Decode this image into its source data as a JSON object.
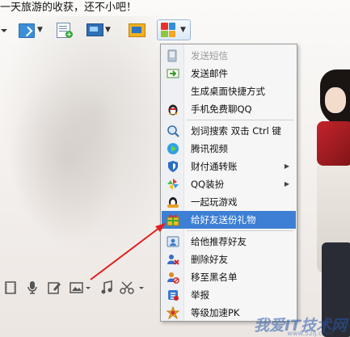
{
  "window": {
    "title": "一天旅游的收获，还不小吧！"
  },
  "toolbar": {
    "buttons": [
      {
        "name": "expand-arrow",
        "icon": "chevron-down-icon"
      },
      {
        "name": "send-file",
        "icon": "file-transfer-icon"
      },
      {
        "name": "new-doc",
        "icon": "doc-plus-icon"
      },
      {
        "name": "remote-screen",
        "icon": "screen-icon"
      },
      {
        "name": "screen-share",
        "icon": "screen-share-icon"
      },
      {
        "name": "apps",
        "icon": "apps-grid-icon"
      }
    ],
    "apps_colors": [
      "#e6332a",
      "#2f8fd8",
      "#8cc63f",
      "#f5a623"
    ]
  },
  "bottom_toolbar": {
    "icons": [
      "film-icon",
      "microphone-icon",
      "edit-icon",
      "image-icon",
      "music-icon",
      "scissors-icon"
    ]
  },
  "context_menu": {
    "highlight_color": "#3d7fd4",
    "items": [
      {
        "label": "发送短信",
        "icon": "sms-icon",
        "disabled": true,
        "submenu": false
      },
      {
        "label": "发送邮件",
        "icon": "mail-icon",
        "disabled": false,
        "submenu": false
      },
      {
        "label": "生成桌面快捷方式",
        "icon": "",
        "disabled": false,
        "submenu": false
      },
      {
        "label": "手机免费聊QQ",
        "icon": "qq-penguin-icon",
        "disabled": false,
        "submenu": false
      },
      {
        "label": "划词搜索 双击 Ctrl 键",
        "icon": "magnifier-icon",
        "disabled": false,
        "submenu": false
      },
      {
        "label": "腾讯视频",
        "icon": "video-play-icon",
        "disabled": false,
        "submenu": false
      },
      {
        "label": "财付通转账",
        "icon": "shield-icon",
        "disabled": false,
        "submenu": true
      },
      {
        "label": "QQ装扮",
        "icon": "pinwheel-icon",
        "disabled": false,
        "submenu": true
      },
      {
        "label": "一起玩游戏",
        "icon": "game-penguin-icon",
        "disabled": false,
        "submenu": false
      },
      {
        "label": "给好友送份礼物",
        "icon": "gift-icon",
        "disabled": false,
        "submenu": false,
        "highlighted": true
      },
      {
        "label": "给他推荐好友",
        "icon": "user-card-icon",
        "disabled": false,
        "submenu": false
      },
      {
        "label": "删除好友",
        "icon": "user-delete-icon",
        "disabled": false,
        "submenu": false
      },
      {
        "label": "移至黑名单",
        "icon": "user-block-icon",
        "disabled": false,
        "submenu": false
      },
      {
        "label": "举报",
        "icon": "report-icon",
        "disabled": false,
        "submenu": false
      },
      {
        "label": "等级加速PK",
        "icon": "level-icon",
        "disabled": false,
        "submenu": false
      }
    ]
  },
  "watermark": {
    "text": "我爱IT技术网",
    "url": "www.52ij.com"
  }
}
